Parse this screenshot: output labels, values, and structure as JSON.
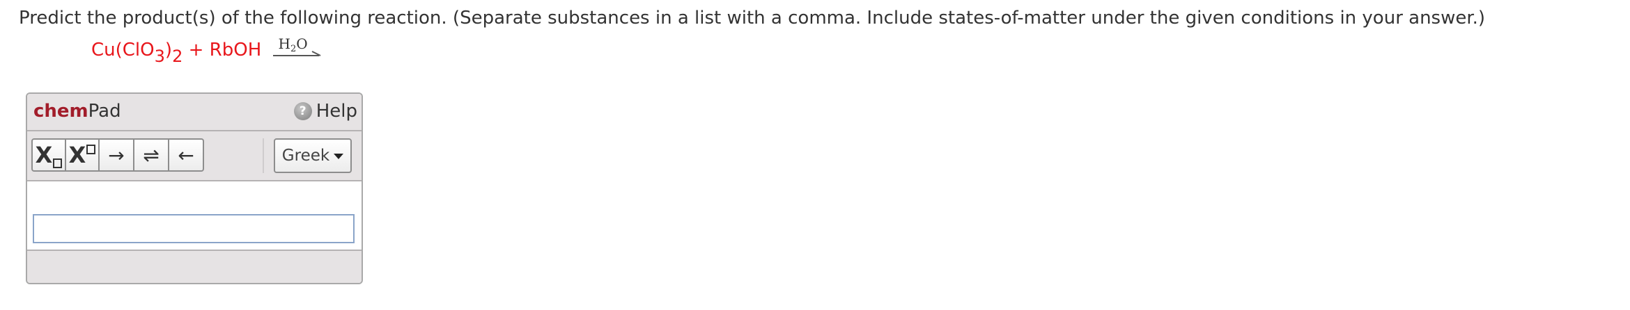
{
  "question": {
    "text": "Predict the product(s) of the following reaction. (Separate substances in a list with a comma. Include states-of-matter under the given conditions in your answer.)"
  },
  "reaction": {
    "reactant1_main": "Cu(ClO",
    "reactant1_sub1": "3",
    "reactant1_close": ")",
    "reactant1_sub2": "2",
    "plus": " + ",
    "reactant2": "RbOH",
    "condition_main": "H",
    "condition_sub": "2",
    "condition_end": "O",
    "color": "#e8161b"
  },
  "chempad": {
    "brand": "chem",
    "brand_rest": "Pad",
    "help_label": "Help",
    "help_icon": "question-mark-icon",
    "greek_label": "Greek",
    "subscript_label": "X",
    "superscript_label": "X",
    "arrow_right": "→",
    "arrow_equilibrium": "⇌",
    "arrow_left": "←",
    "answer_value": "",
    "brand_color": "#a21d2a"
  }
}
